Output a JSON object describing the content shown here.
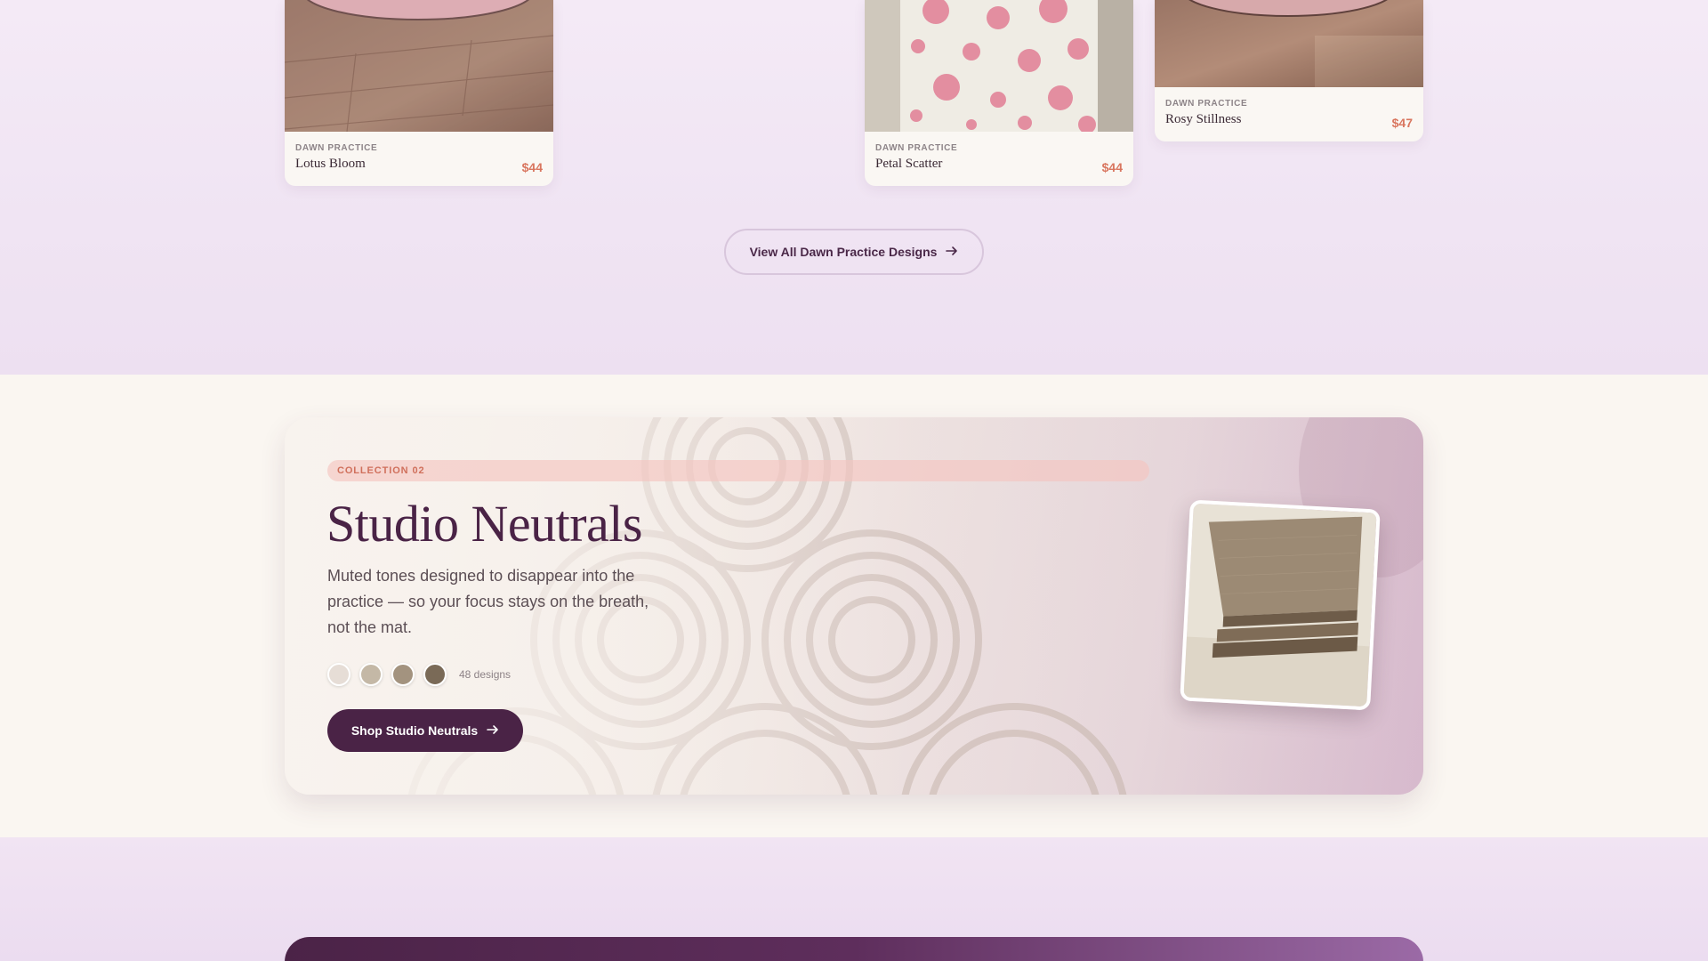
{
  "products": [
    {
      "collection": "DAWN PRACTICE",
      "name": "Lotus Bloom",
      "price": "$44"
    },
    {
      "collection": "DAWN PRACTICE",
      "name": "Petal Scatter",
      "price": "$44"
    },
    {
      "collection": "DAWN PRACTICE",
      "name": "Rosy Stillness",
      "price": "$47"
    }
  ],
  "view_all": {
    "label": "View All Dawn Practice Designs",
    "icon": "arrow-right-icon"
  },
  "hero": {
    "badge": "COLLECTION 02",
    "title": "Studio Neutrals",
    "description": "Muted tones designed to disappear into the practice — so your focus stays on the breath, not the mat.",
    "swatches": [
      "#e6ddd6",
      "#c4b8a6",
      "#a3937f",
      "#7a6a57"
    ],
    "design_count": "48 designs",
    "cta": {
      "label": "Shop Studio Neutrals",
      "icon": "arrow-right-icon"
    }
  },
  "colors": {
    "accent": "#4a2346",
    "price": "#d9765f",
    "badge_text": "#d0705c"
  }
}
